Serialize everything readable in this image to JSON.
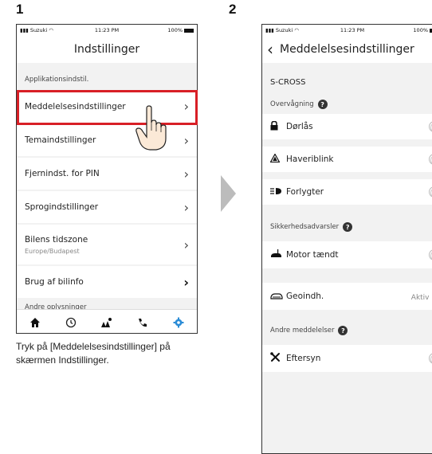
{
  "steps": [
    "1",
    "2"
  ],
  "left": {
    "status": {
      "carrier": "Suzuki",
      "time": "11:23 PM",
      "battery": "100%"
    },
    "title": "Indstillinger",
    "section1": "Applikationsindstil.",
    "items": [
      {
        "label": "Meddelelsesindstillinger",
        "sub": ""
      },
      {
        "label": "Temaindstillinger",
        "sub": ""
      },
      {
        "label": "Fjernindst. for PIN",
        "sub": ""
      },
      {
        "label": "Sprogindstillinger",
        "sub": ""
      },
      {
        "label": "Bilens tidszone",
        "sub": "Europe/Budapest"
      },
      {
        "label": "Brug af bilinfo",
        "sub": ""
      }
    ],
    "section2": "Andre oplysninger",
    "tabs": [
      "home-icon",
      "history-icon",
      "map-icon",
      "phone-icon",
      "settings-icon"
    ],
    "accent": "#2b8cd6",
    "highlight_color": "#d81f26"
  },
  "caption": "Tryk på [Meddelelsesindstillinger] på skærmen Indstillinger.",
  "right": {
    "status": {
      "carrier": "Suzuki",
      "time": "11:23 PM",
      "battery": "100%"
    },
    "back": "‹",
    "title": "Meddelelsesindstillinger",
    "model": "S-CROSS",
    "sec_monitor": "Overvågning",
    "monitor_items": [
      "Dørlås",
      "Haveriblink",
      "Forlygter"
    ],
    "sec_safety": "Sikkerhedsadvarsler",
    "safety_items": [
      "Motor tændt"
    ],
    "geo_label": "Geoindh.",
    "geo_value": "Aktiv",
    "sec_other": "Andre meddelelser",
    "other_items": [
      "Eftersyn"
    ]
  }
}
